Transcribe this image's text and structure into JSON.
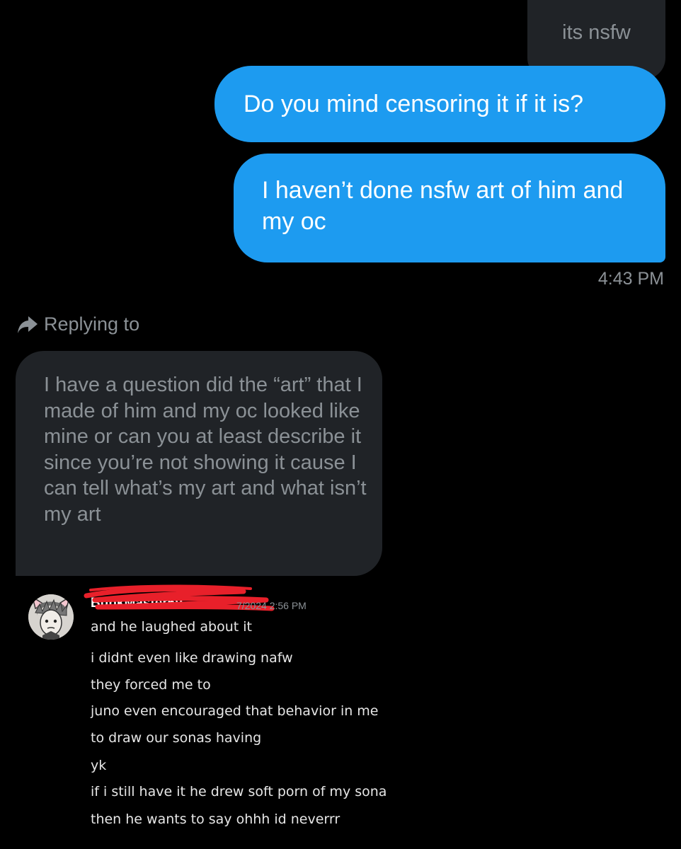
{
  "chat": {
    "top_gray_message": "its nsfw",
    "sent_message_1": "Do you mind censoring it if it is?",
    "sent_message_2": "I haven’t done nsfw art of him and my oc",
    "sent_time": "4:43 PM"
  },
  "reply": {
    "label": "Replying to",
    "icon": "reply-arrow-icon",
    "quoted_text": "I have a question did the “art” that I made of him and my oc looked like mine or can you at least describe it since you’re not showing it cause I can tell what’s my art and what isn’t my art"
  },
  "screenshot": {
    "username": "BunkMaster69",
    "time": "7/2024 2:56 PM",
    "messages": [
      "and he laughed about it",
      "i didnt even like drawing nafw",
      "they forced me to",
      "juno even encouraged that behavior in me",
      "to draw our sonas having",
      "yk",
      "if i still have it he drew soft porn of my sona",
      "then he wants to say ohhh id neverrr"
    ]
  },
  "colors": {
    "background": "#000000",
    "sent_bubble": "#1d9bf0",
    "received_bubble": "#202327",
    "muted_text": "#8b9196",
    "redaction": "#e8202a"
  }
}
